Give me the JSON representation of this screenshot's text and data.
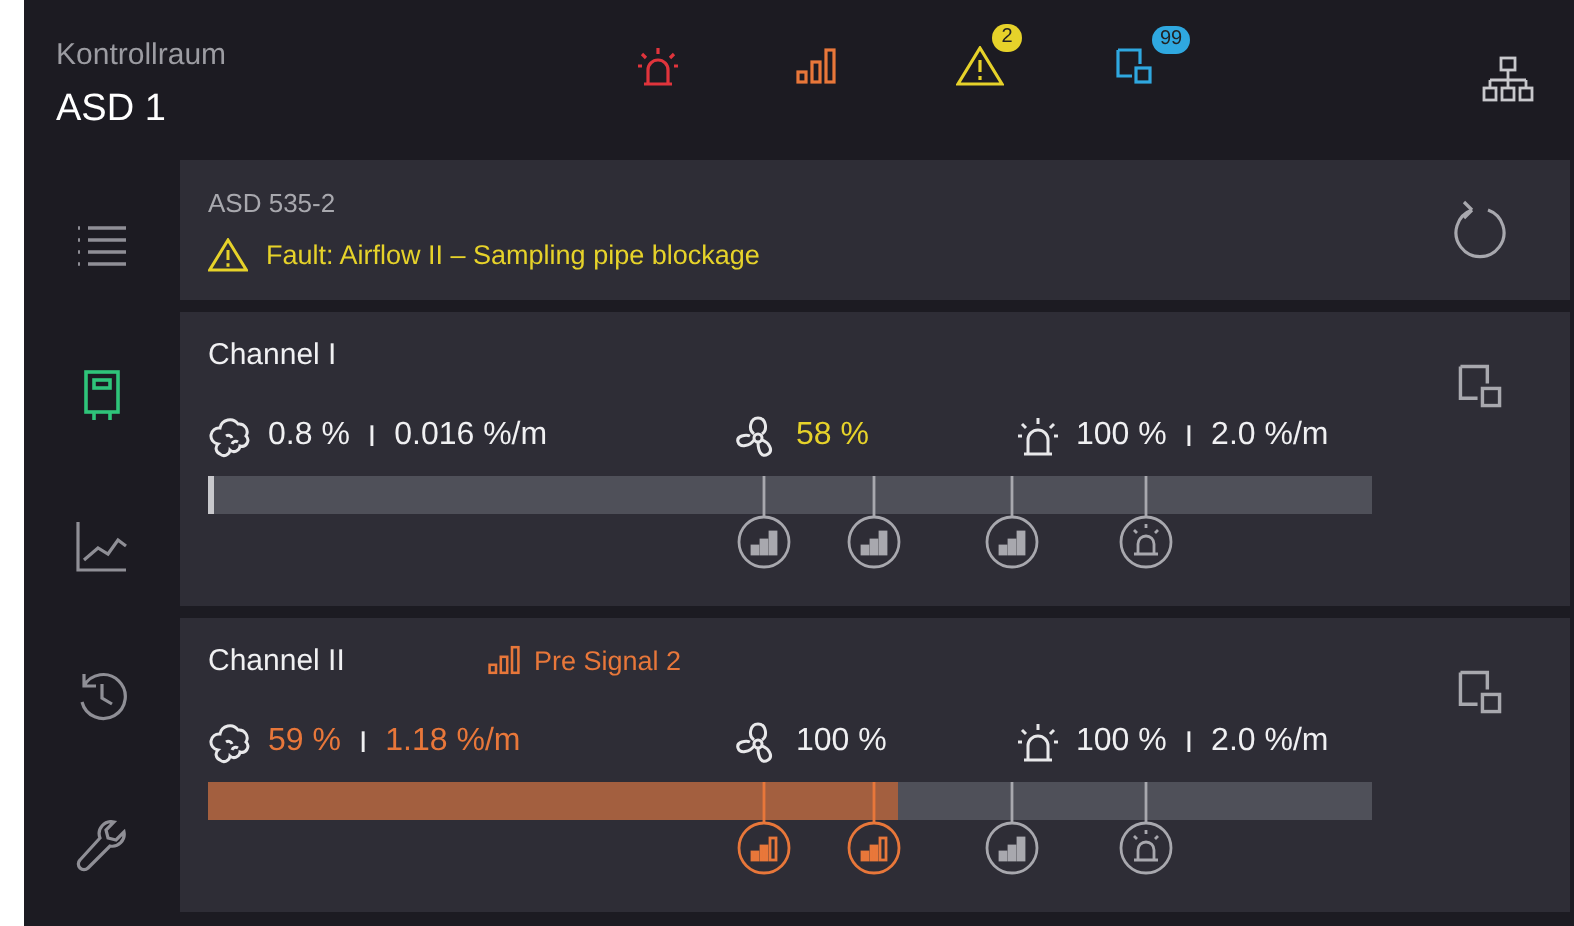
{
  "header": {
    "subtitle": "Kontrollraum",
    "title": "ASD 1",
    "status_icons": [
      {
        "kind": "alarm",
        "color": "#e0343c"
      },
      {
        "kind": "signal",
        "color": "#e8773a"
      },
      {
        "kind": "warning",
        "color": "#e6d22a",
        "badge": "2"
      },
      {
        "kind": "device",
        "color": "#2fa8e0",
        "badge": "99"
      }
    ]
  },
  "sidebar": {
    "items": [
      {
        "kind": "list",
        "selected": false
      },
      {
        "kind": "device",
        "selected": true
      },
      {
        "kind": "chart",
        "selected": false
      },
      {
        "kind": "history",
        "selected": false
      },
      {
        "kind": "settings",
        "selected": false
      }
    ]
  },
  "fault": {
    "device": "ASD 535-2",
    "message": "Fault: Airflow II – Sampling pipe blockage"
  },
  "channels": [
    {
      "name": "Channel I",
      "smoke": {
        "value": "0.8 %",
        "separator": "I",
        "rate": "0.016 %/m",
        "alert": false
      },
      "airflow": {
        "value": "58 %",
        "warning": true
      },
      "alarm": {
        "value": "100 %",
        "separator": "I",
        "rate": "2.0 %/m"
      },
      "level": 0.006,
      "markers": [
        {
          "kind": "signal",
          "level": 0.478,
          "reached": false
        },
        {
          "kind": "signal",
          "level": 0.572,
          "reached": false
        },
        {
          "kind": "signal",
          "level": 0.691,
          "reached": false
        },
        {
          "kind": "alarm",
          "level": 0.806,
          "reached": false
        }
      ]
    },
    {
      "name": "Channel II",
      "status": "Pre Signal 2",
      "smoke": {
        "value": "59 %",
        "separator": "I",
        "rate": "1.18 %/m",
        "alert": true
      },
      "airflow": {
        "value": "100 %",
        "warning": false
      },
      "alarm": {
        "value": "100 %",
        "separator": "I",
        "rate": "2.0 %/m"
      },
      "level": 0.593,
      "markers": [
        {
          "kind": "signal",
          "level": 0.478,
          "reached": true
        },
        {
          "kind": "signal",
          "level": 0.572,
          "reached": true
        },
        {
          "kind": "signal",
          "level": 0.691,
          "reached": false
        },
        {
          "kind": "alarm",
          "level": 0.806,
          "reached": false
        }
      ]
    }
  ]
}
